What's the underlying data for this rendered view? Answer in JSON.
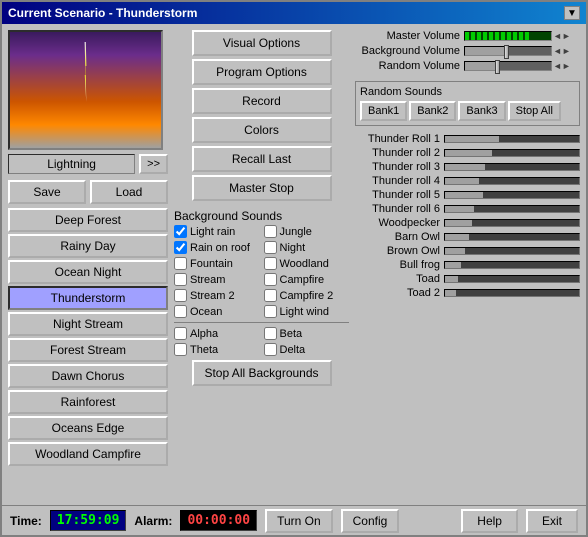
{
  "window": {
    "title": "Current Scenario - Thunderstorm"
  },
  "preview": {
    "label": "Lightning",
    "arrow_label": ">>"
  },
  "save_load": {
    "save_label": "Save",
    "load_label": "Load"
  },
  "scenarios": [
    {
      "label": "Deep Forest",
      "active": false
    },
    {
      "label": "Rainy Day",
      "active": false
    },
    {
      "label": "Ocean Night",
      "active": false
    },
    {
      "label": "Thunderstorm",
      "active": true
    },
    {
      "label": "Night Stream",
      "active": false
    },
    {
      "label": "Forest Stream",
      "active": false
    },
    {
      "label": "Dawn Chorus",
      "active": false
    },
    {
      "label": "Rainforest",
      "active": false
    },
    {
      "label": "Oceans Edge",
      "active": false
    },
    {
      "label": "Woodland Campfire",
      "active": false
    }
  ],
  "action_buttons": {
    "visual_options": "Visual Options",
    "program_options": "Program Options",
    "record": "Record",
    "colors": "Colors",
    "recall_last": "Recall Last",
    "master_stop": "Master Stop"
  },
  "background_sounds": {
    "title": "Background Sounds",
    "sounds": [
      {
        "label": "Light rain",
        "checked": true
      },
      {
        "label": "Jungle",
        "checked": false
      },
      {
        "label": "Rain on roof",
        "checked": true
      },
      {
        "label": "Night",
        "checked": false
      },
      {
        "label": "Fountain",
        "checked": false
      },
      {
        "label": "Woodland",
        "checked": false
      },
      {
        "label": "Stream",
        "checked": false
      },
      {
        "label": "Campfire",
        "checked": false
      },
      {
        "label": "Stream 2",
        "checked": false
      },
      {
        "label": "Campfire 2",
        "checked": false
      },
      {
        "label": "Ocean",
        "checked": false
      },
      {
        "label": "Light wind",
        "checked": false
      }
    ],
    "waves": [
      {
        "label": "Alpha",
        "checked": false
      },
      {
        "label": "Beta",
        "checked": false
      },
      {
        "label": "Theta",
        "checked": false
      },
      {
        "label": "Delta",
        "checked": false
      }
    ],
    "stop_all_label": "Stop All Backgrounds"
  },
  "volume": {
    "master_label": "Master Volume",
    "background_label": "Background Volume",
    "random_label": "Random Volume"
  },
  "random_sounds": {
    "title": "Random Sounds",
    "bank1": "Bank1",
    "bank2": "Bank2",
    "bank3": "Bank3",
    "stop_all": "Stop All"
  },
  "sound_sliders": [
    {
      "name": "Thunder Roll 1",
      "level": 40
    },
    {
      "name": "Thunder roll 2",
      "level": 35
    },
    {
      "name": "Thunder roll 3",
      "level": 30
    },
    {
      "name": "Thunder roll 4",
      "level": 25
    },
    {
      "name": "Thunder roll 5",
      "level": 28
    },
    {
      "name": "Thunder roll 6",
      "level": 22
    },
    {
      "name": "Woodpecker",
      "level": 20
    },
    {
      "name": "Barn Owl",
      "level": 18
    },
    {
      "name": "Brown Owl",
      "level": 15
    },
    {
      "name": "Bull frog",
      "level": 12
    },
    {
      "name": "Toad",
      "level": 10
    },
    {
      "name": "Toad 2",
      "level": 8
    }
  ],
  "status_bar": {
    "time_label": "Time:",
    "time_value": "17:59:09",
    "alarm_label": "Alarm:",
    "alarm_value": "00:00:00",
    "turn_on": "Turn On",
    "config": "Config",
    "help": "Help",
    "exit": "Exit"
  }
}
